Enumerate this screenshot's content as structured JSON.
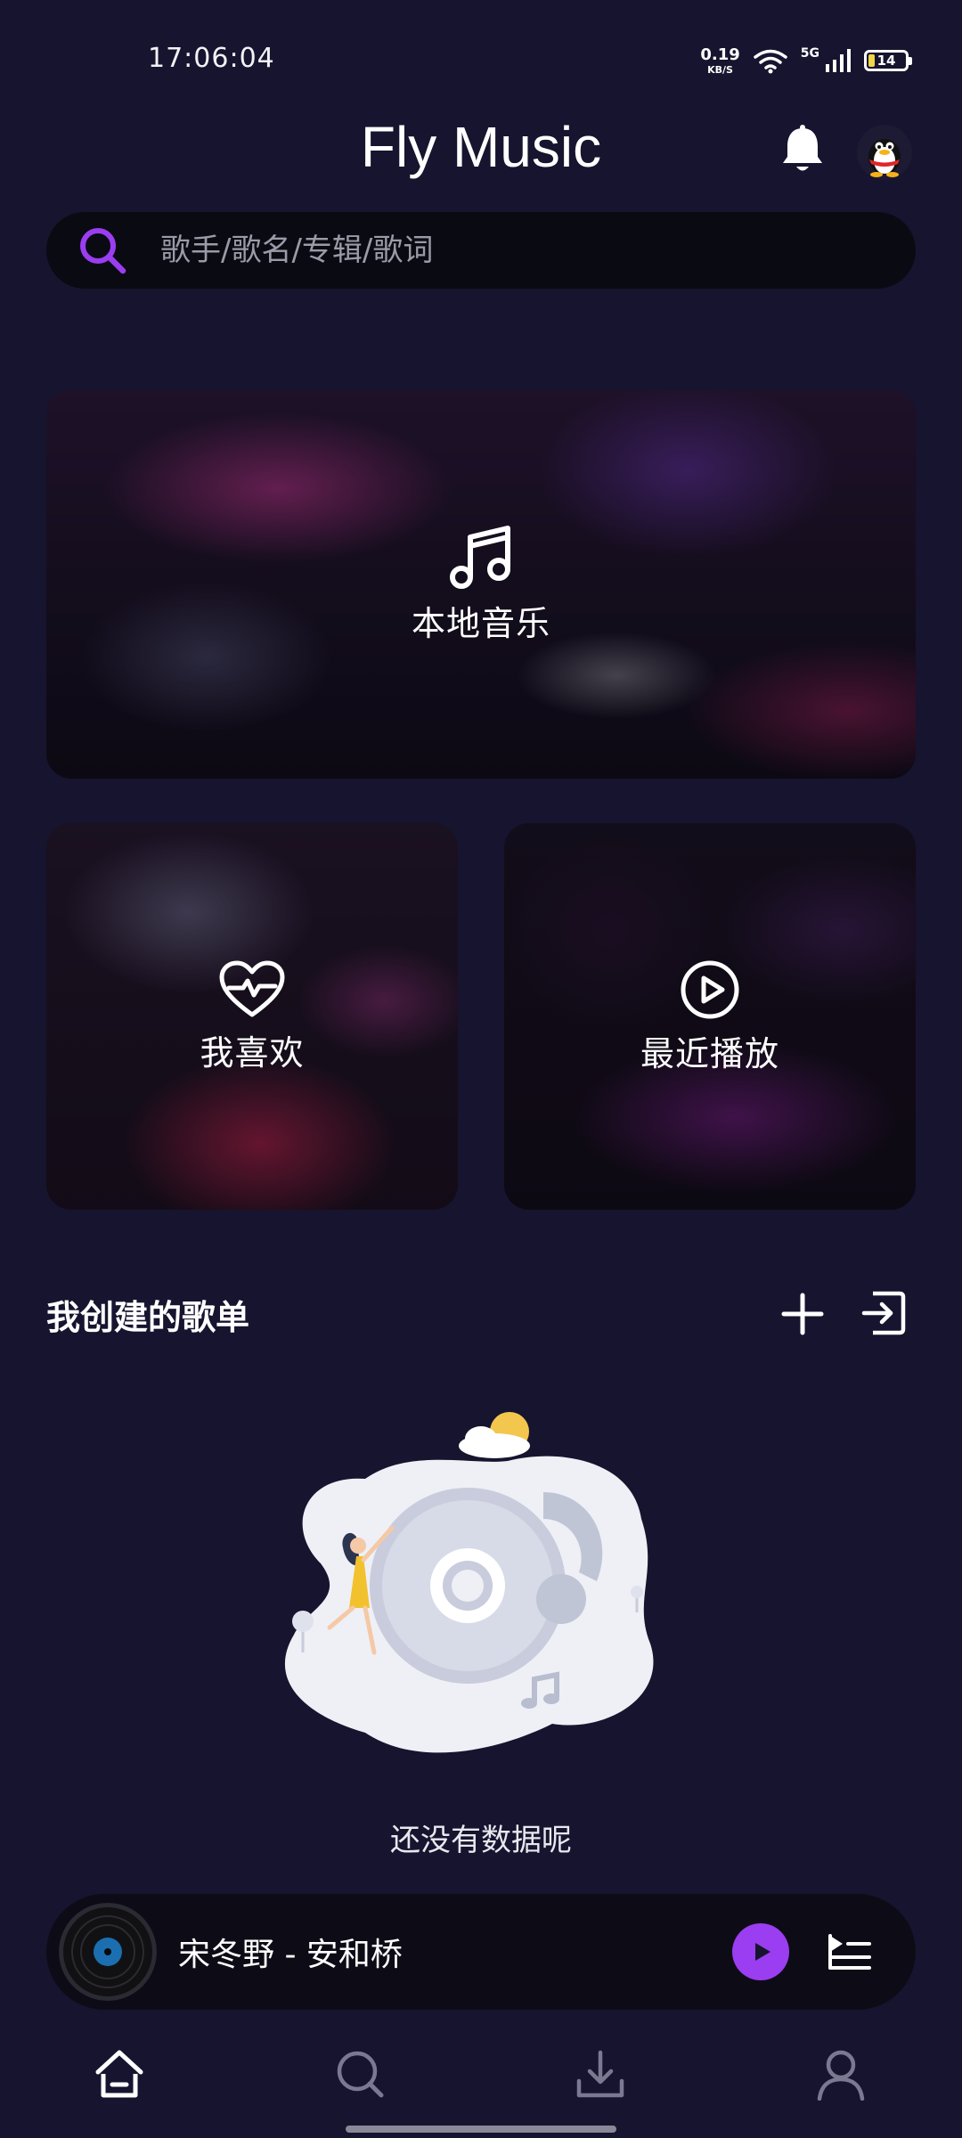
{
  "status_bar": {
    "time": "17:06:04",
    "net_speed_value": "0.19",
    "net_speed_unit": "KB/S",
    "network_type": "5G",
    "battery_level": "14",
    "icons": [
      "wifi-icon",
      "cell-signal-icon",
      "battery-icon"
    ]
  },
  "header": {
    "title": "Fly Music",
    "icons": [
      "bell-icon",
      "avatar"
    ]
  },
  "search": {
    "placeholder": "歌手/歌名/专辑/歌词",
    "icon": "search-icon"
  },
  "cards": {
    "local": {
      "label": "本地音乐",
      "icon": "music-note-icon"
    },
    "favorites": {
      "label": "我喜欢",
      "icon": "heart-pulse-icon"
    },
    "recent": {
      "label": "最近播放",
      "icon": "play-circle-icon"
    }
  },
  "playlists": {
    "title": "我创建的歌单",
    "actions": [
      "add-icon",
      "import-icon"
    ],
    "empty_text": "还没有数据呢"
  },
  "player": {
    "track": "宋冬野 - 安和桥",
    "icons": [
      "disc-icon",
      "play-icon",
      "queue-icon"
    ]
  },
  "nav": {
    "items": [
      "home-icon",
      "search-icon",
      "download-icon",
      "profile-icon"
    ],
    "active": "home-icon"
  },
  "colors": {
    "background": "#17142f",
    "search_bg": "#0a0a12",
    "accent_purple": "#9b3df0",
    "player_bg": "#0d0c16"
  }
}
